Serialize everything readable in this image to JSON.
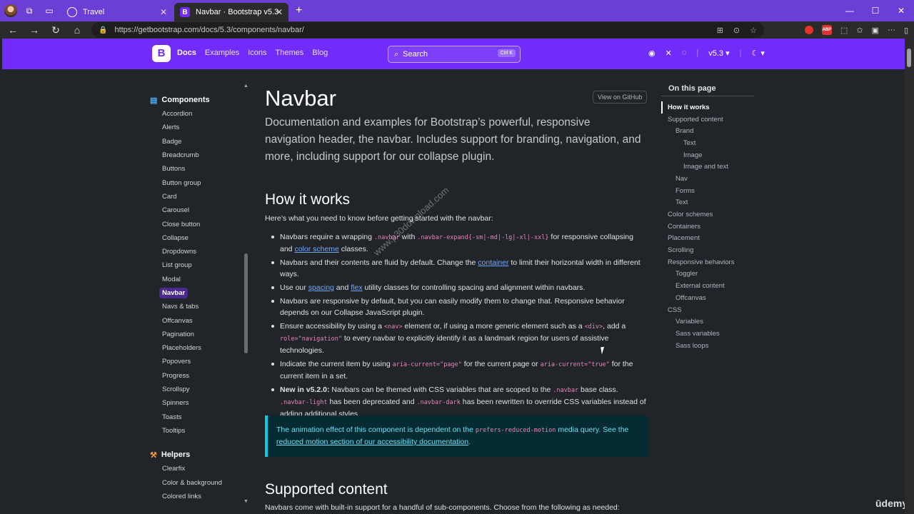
{
  "browser": {
    "tabs": [
      {
        "title": "Travel",
        "active": false
      },
      {
        "title": "Navbar · Bootstrap v5.3",
        "active": true
      }
    ],
    "url": "https://getbootstrap.com/docs/5.3/components/navbar/"
  },
  "header": {
    "logo": "B",
    "nav": [
      "Docs",
      "Examples",
      "Icons",
      "Themes",
      "Blog"
    ],
    "search_placeholder": "Search",
    "search_shortcut": "Ctrl K",
    "version": "v5.3",
    "brand_color": "#712cf9"
  },
  "sidebar": {
    "components_title": "Components",
    "components": [
      "Accordion",
      "Alerts",
      "Badge",
      "Breadcrumb",
      "Buttons",
      "Button group",
      "Card",
      "Carousel",
      "Close button",
      "Collapse",
      "Dropdowns",
      "List group",
      "Modal",
      "Navbar",
      "Navs & tabs",
      "Offcanvas",
      "Pagination",
      "Placeholders",
      "Popovers",
      "Progress",
      "Scrollspy",
      "Spinners",
      "Toasts",
      "Tooltips"
    ],
    "active_item": "Navbar",
    "helpers_title": "Helpers",
    "helpers": [
      "Clearfix",
      "Color & background",
      "Colored links"
    ]
  },
  "main": {
    "title": "Navbar",
    "github_button": "View on GitHub",
    "lead": "Documentation and examples for Bootstrap’s powerful, responsive navigation header, the navbar. Includes support for branding, navigation, and more, including support for our collapse plugin.",
    "section1_title": "How it works",
    "section1_intro": "Here’s what you need to know before getting started with the navbar:",
    "b1": {
      "t1": "Navbars require a wrapping ",
      "c1": ".navbar",
      "t2": " with ",
      "c2": ".navbar-expand{-sm|-md|-lg|-xl|-xxl}",
      "t3": " for responsive collapsing and ",
      "link": "color scheme",
      "t4": " classes."
    },
    "b2": {
      "t1": "Navbars and their contents are fluid by default. Change the ",
      "link": "container",
      "t2": " to limit their horizontal width in different ways."
    },
    "b3": {
      "t1": "Use our ",
      "link1": "spacing",
      "t2": " and ",
      "link2": "flex",
      "t3": " utility classes for controlling spacing and alignment within navbars."
    },
    "b4": "Navbars are responsive by default, but you can easily modify them to change that. Responsive behavior depends on our Collapse JavaScript plugin.",
    "b5": {
      "t1": "Ensure accessibility by using a ",
      "c1": "<nav>",
      "t2": " element or, if using a more generic element such as a ",
      "c2": "<div>",
      "t3": ", add a ",
      "c3": "role=\"navigation\"",
      "t4": " to every navbar to explicitly identify it as a landmark region for users of assistive technologies."
    },
    "b6": {
      "t1": "Indicate the current item by using ",
      "c1": "aria-current=\"page\"",
      "t2": " for the current page or ",
      "c2": "aria-current=\"true\"",
      "t3": " for the current item in a set."
    },
    "b7": {
      "bold": "New in v5.2.0:",
      "t1": " Navbars can be themed with CSS variables that are scoped to the ",
      "c1": ".navbar",
      "t2": " base class. ",
      "c2": ".navbar-light",
      "t3": " has been deprecated and ",
      "c3": ".navbar-dark",
      "t4": " has been rewritten to override CSS variables instead of adding additional styles."
    },
    "callout": {
      "t1": "The animation effect of this component is dependent on the ",
      "c1": "prefers-reduced-motion",
      "t2": " media query. See the ",
      "link": "reduced motion section of our accessibility documentation",
      "t3": "."
    },
    "section2_title": "Supported content",
    "section2_intro": "Navbars come with built-in support for a handful of sub-components. Choose from the following as needed:"
  },
  "toc": {
    "title": "On this page",
    "items": [
      {
        "label": "How it works",
        "level": 1,
        "current": true
      },
      {
        "label": "Supported content",
        "level": 1
      },
      {
        "label": "Brand",
        "level": 2
      },
      {
        "label": "Text",
        "level": 3
      },
      {
        "label": "Image",
        "level": 3
      },
      {
        "label": "Image and text",
        "level": 3
      },
      {
        "label": "Nav",
        "level": 2
      },
      {
        "label": "Forms",
        "level": 2
      },
      {
        "label": "Text",
        "level": 2
      },
      {
        "label": "Color schemes",
        "level": 1
      },
      {
        "label": "Containers",
        "level": 1
      },
      {
        "label": "Placement",
        "level": 1
      },
      {
        "label": "Scrolling",
        "level": 1
      },
      {
        "label": "Responsive behaviors",
        "level": 1
      },
      {
        "label": "Toggler",
        "level": 2
      },
      {
        "label": "External content",
        "level": 2
      },
      {
        "label": "Offcanvas",
        "level": 2
      },
      {
        "label": "CSS",
        "level": 1
      },
      {
        "label": "Variables",
        "level": 2
      },
      {
        "label": "Sass variables",
        "level": 2
      },
      {
        "label": "Sass loops",
        "level": 2
      }
    ]
  },
  "watermark": "www.p30download.com",
  "overlay_logo": "ūdemy"
}
